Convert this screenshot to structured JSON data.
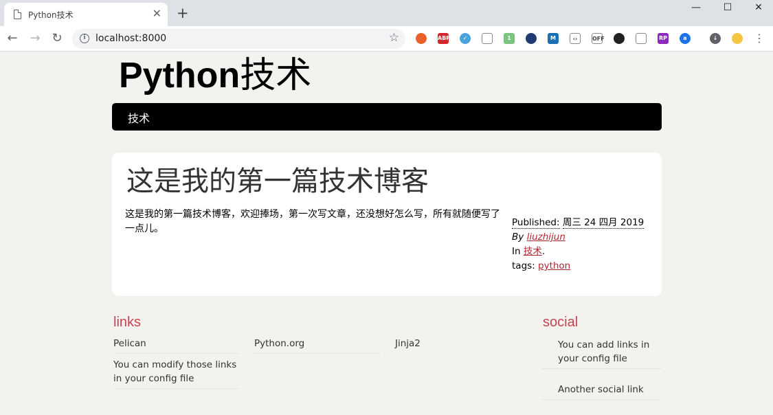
{
  "browser": {
    "tab_title": "Python技术",
    "tab_close": "✕",
    "new_tab": "+",
    "url": "localhost:8000",
    "window": {
      "minimize": "—",
      "maximize": "☐",
      "close": "✕"
    },
    "extensions": [
      {
        "name": "extension-orange-icon",
        "color": "#e8622c",
        "glyph": ""
      },
      {
        "name": "adblock-plus-icon",
        "color": "#d5262e",
        "glyph": "ABP"
      },
      {
        "name": "extension-blue-check-icon",
        "color": "#4aa3df",
        "glyph": "✓"
      },
      {
        "name": "extension-cursor-icon",
        "color": "#ffffff",
        "glyph": ""
      },
      {
        "name": "extension-badge-icon",
        "color": "#7bc47f",
        "glyph": "1"
      },
      {
        "name": "extension-circle-icon",
        "color": "#1e3c72",
        "glyph": ""
      },
      {
        "name": "extension-m-icon",
        "color": "#1a6fb5",
        "glyph": "M"
      },
      {
        "name": "extension-code-icon",
        "color": "#ffffff",
        "glyph": "‹›"
      },
      {
        "name": "extension-off-icon",
        "color": "#ffffff",
        "glyph": "OFF"
      },
      {
        "name": "extension-color-wheel-icon",
        "color": "#222222",
        "glyph": ""
      },
      {
        "name": "extension-shield-icon",
        "color": "#ffffff",
        "glyph": ""
      },
      {
        "name": "extension-rp-icon",
        "color": "#8a2bbd",
        "glyph": "RP"
      },
      {
        "name": "extension-a-icon",
        "color": "#1a73e8",
        "glyph": "a"
      },
      {
        "name": "download-icon",
        "color": "#5f6368",
        "glyph": "↓"
      },
      {
        "name": "profile-avatar-icon",
        "color": "#f4c542",
        "glyph": ""
      }
    ]
  },
  "site": {
    "title_latin": "Python",
    "title_cjk": "技术",
    "nav": [
      "技术"
    ]
  },
  "article": {
    "title": "这是我的第一篇技术博客",
    "body": "这是我的第一篇技术博客，欢迎捧场，第一次写文章，还没想好怎么写，所有就随便写了一点儿。",
    "published_label": "Published:",
    "published_date": "周三 24 四月 2019",
    "by_label": "By",
    "author": "liuzhijun",
    "in_label": "In",
    "category": "技术",
    "category_suffix": ".",
    "tags_label": "tags:",
    "tags": [
      "python"
    ]
  },
  "links": {
    "heading": "links",
    "items": [
      "Pelican",
      "Python.org",
      "Jinja2",
      "You can modify those links in your config file"
    ]
  },
  "social": {
    "heading": "social",
    "items": [
      "You can add links in your config file",
      "Another social link"
    ]
  }
}
